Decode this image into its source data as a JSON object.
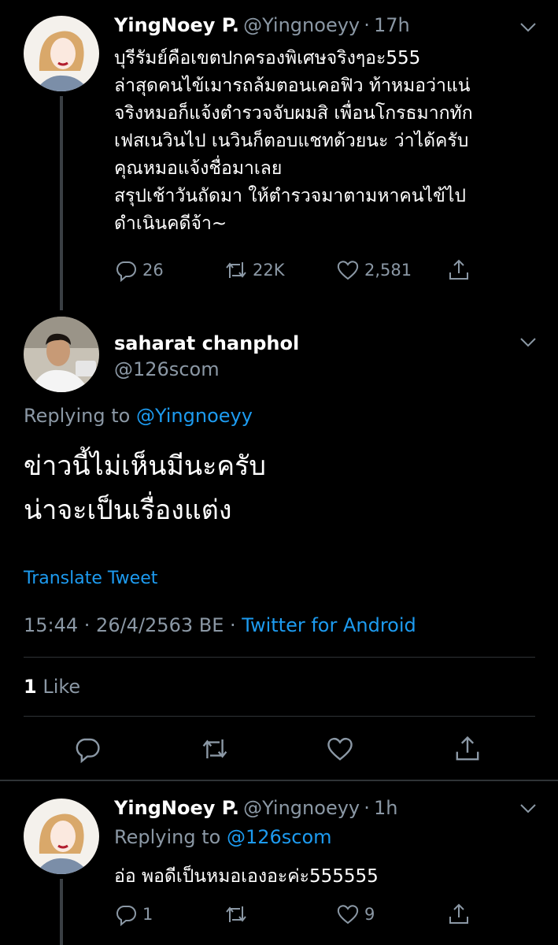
{
  "tweet1": {
    "name": "YingNoey P.",
    "handle": "@Yingnoeyy",
    "separator": "·",
    "time": "17h",
    "text": "บุรีรัมย์คือเขตปกครองพิเศษจริงๆอะ555\nล่าสุดคนไข้เมารถล้มตอนเคอฟิว ท้าหมอว่าแน่\nจริงหมอก็แจ้งตำรวจจับผมสิ เพื่อนโกรธมากทัก\nเฟสเนวินไป เนวินก็ตอบแชทด้วยนะ ว่าได้ครับ\nคุณหมอแจ้งชื่อมาเลย\nสรุปเช้าวันถัดมา ให้ตำรวจมาตามหาคนไข้ไป\nดำเนินคดีจ้า~",
    "replies": "26",
    "retweets": "22K",
    "likes": "2,581"
  },
  "main": {
    "name": "saharat chanphol",
    "handle": "@126scom",
    "replying_prefix": "Replying to",
    "replying_handle": "@Yingnoeyy",
    "text": "ข่าวนี้ไม่เห็นมีนะครับ\nน่าจะเป็นเรื่องแต่ง",
    "translate": "Translate Tweet",
    "time": "15:44 · 26/4/2563 BE ·",
    "source": "Twitter for Android",
    "like_count": "1",
    "like_label": "Like"
  },
  "tweet3": {
    "name": "YingNoey P.",
    "handle": "@Yingnoeyy",
    "separator": "·",
    "time": "1h",
    "replying_prefix": "Replying to",
    "replying_handle": "@126scom",
    "text": "อ่อ พอดีเป็นหมอเองอะค่ะ555555",
    "replies": "1",
    "retweets": "",
    "likes": "9"
  },
  "colors": {
    "background": "#000000",
    "text": "#ffffff",
    "secondary": "#8b98a5",
    "accent": "#1d9bf0",
    "divider": "#2f3336"
  },
  "icons": [
    "reply-icon",
    "retweet-icon",
    "like-icon",
    "share-icon",
    "chevron-down-icon"
  ]
}
